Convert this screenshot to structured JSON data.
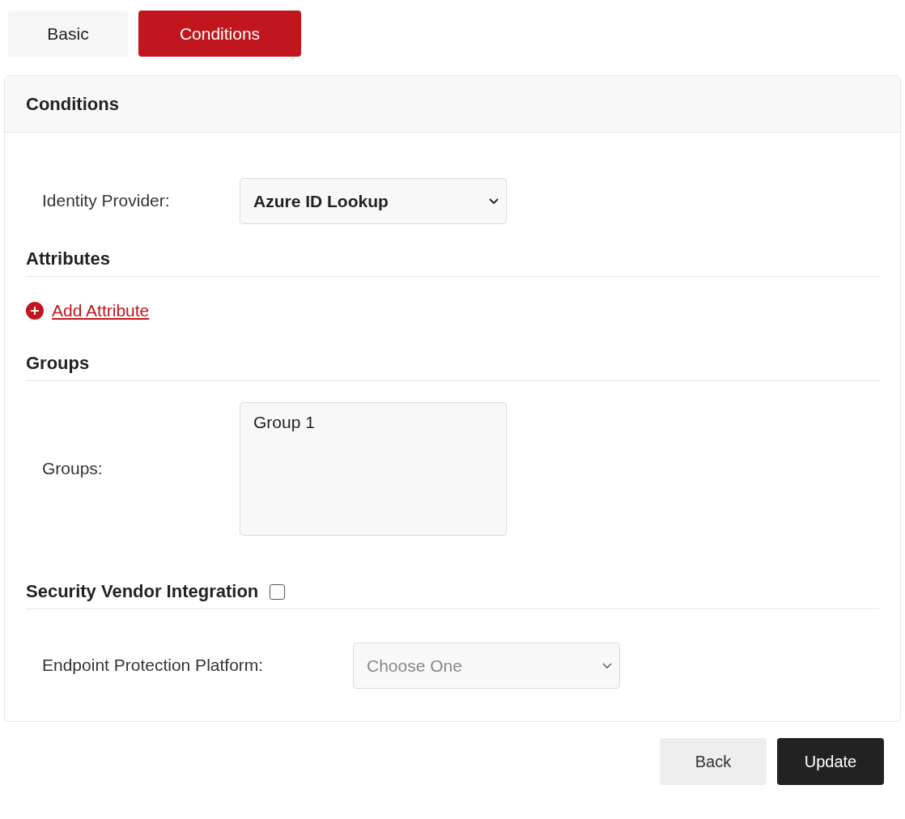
{
  "tabs": [
    {
      "label": "Basic",
      "selected": false
    },
    {
      "label": "Conditions",
      "selected": true
    }
  ],
  "panel": {
    "title": "Conditions",
    "identity_provider": {
      "label": "Identity Provider:",
      "value": "Azure ID Lookup"
    },
    "attributes": {
      "heading": "Attributes",
      "add_link": "Add Attribute"
    },
    "groups": {
      "heading": "Groups",
      "label": "Groups:",
      "options": [
        {
          "label": "Group 1",
          "selected": false
        }
      ]
    },
    "security_vendor": {
      "heading": "Security Vendor Integration",
      "checked": false,
      "endpoint": {
        "label": "Endpoint Protection Platform:",
        "value": "Choose One",
        "disabled": true
      }
    }
  },
  "buttons": [
    {
      "label": "Back",
      "kind": "secondary"
    },
    {
      "label": "Update",
      "kind": "primary"
    }
  ]
}
